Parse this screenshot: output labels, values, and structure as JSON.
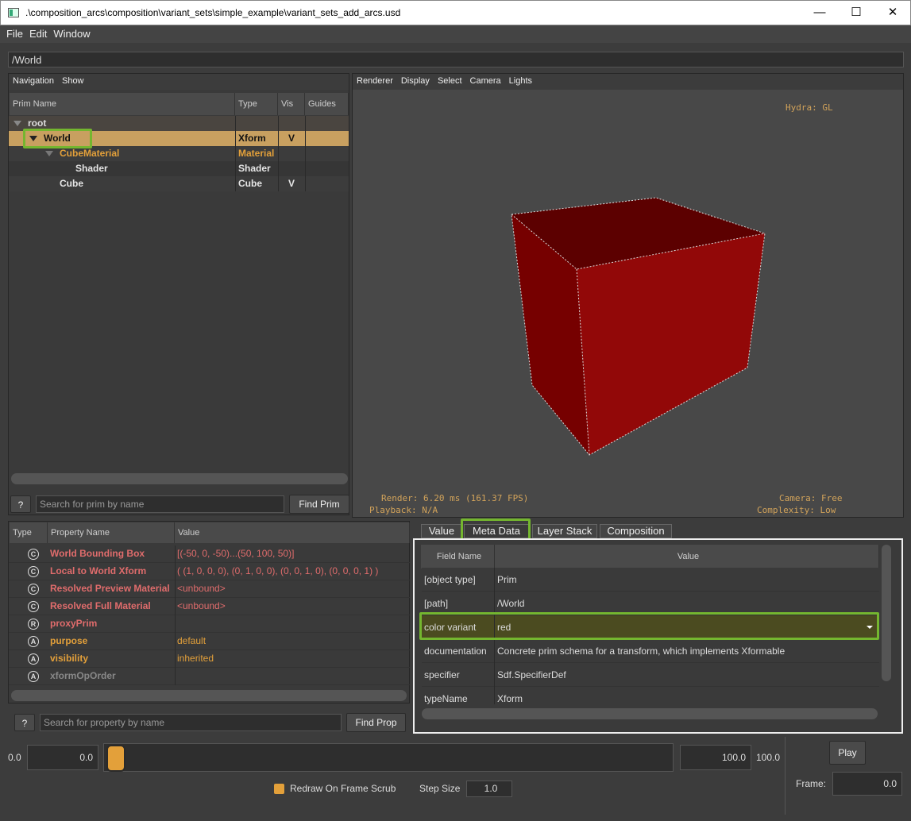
{
  "window": {
    "title": ".\\composition_arcs\\composition\\variant_sets\\simple_example\\variant_sets_add_arcs.usd",
    "minimize": "—",
    "maximize": "☐",
    "close": "✕"
  },
  "menu": [
    "File",
    "Edit",
    "Window"
  ],
  "path": "/World",
  "nav_toolbar": [
    "Navigation",
    "Show"
  ],
  "prim_tree": {
    "columns": [
      "Prim Name",
      "Type",
      "Vis",
      "Guides"
    ],
    "rows": [
      {
        "name": "root",
        "type": "",
        "vis": ""
      },
      {
        "name": "World",
        "type": "Xform",
        "vis": "V"
      },
      {
        "name": "CubeMaterial",
        "type": "Material",
        "vis": ""
      },
      {
        "name": "Shader",
        "type": "Shader",
        "vis": ""
      },
      {
        "name": "Cube",
        "type": "Cube",
        "vis": "V"
      }
    ]
  },
  "prim_search": {
    "help": "?",
    "placeholder": "Search for prim by name",
    "button": "Find Prim"
  },
  "viewport_toolbar": [
    "Renderer",
    "Display",
    "Select",
    "Camera",
    "Lights"
  ],
  "viewport_hud": {
    "renderer": "Hydra: GL",
    "render": "Render: 6.20 ms (161.37 FPS)",
    "playback": "Playback: N/A",
    "camera": "Camera: Free",
    "complexity": "Complexity: Low"
  },
  "properties": {
    "columns": [
      "Type",
      "Property Name",
      "Value"
    ],
    "rows": [
      {
        "icon": "C",
        "name": "World Bounding Box",
        "value": "[(-50, 0, -50)...(50, 100, 50)]",
        "color": "#e06c6c"
      },
      {
        "icon": "C",
        "name": "Local to World Xform",
        "value": "( (1, 0, 0, 0), (0, 1, 0, 0), (0, 0, 1, 0), (0, 0, 0, 1) )",
        "color": "#e06c6c"
      },
      {
        "icon": "C",
        "name": "Resolved Preview Material",
        "value": "<unbound>",
        "color": "#e06c6c"
      },
      {
        "icon": "C",
        "name": "Resolved Full Material",
        "value": "<unbound>",
        "color": "#e06c6c"
      },
      {
        "icon": "R",
        "name": "proxyPrim",
        "value": "",
        "color": "#e06c6c"
      },
      {
        "icon": "A",
        "name": "purpose",
        "value": "default",
        "color": "#e3a03a"
      },
      {
        "icon": "A",
        "name": "visibility",
        "value": "inherited",
        "color": "#e3a03a"
      },
      {
        "icon": "A",
        "name": "xformOpOrder",
        "value": "",
        "color": "#888888"
      }
    ]
  },
  "prop_search": {
    "help": "?",
    "placeholder": "Search for property by name",
    "button": "Find Prop"
  },
  "tabs": [
    "Value",
    "Meta Data",
    "Layer Stack",
    "Composition"
  ],
  "meta": {
    "columns": [
      "Field Name",
      "Value"
    ],
    "rows": [
      {
        "field": "[object type]",
        "value": "Prim"
      },
      {
        "field": "[path]",
        "value": "/World"
      },
      {
        "field": "color variant",
        "value": "red"
      },
      {
        "field": "documentation",
        "value": "Concrete prim schema for a transform, which implements Xformable"
      },
      {
        "field": "specifier",
        "value": "Sdf.SpecifierDef"
      },
      {
        "field": "typeName",
        "value": "Xform"
      }
    ]
  },
  "timeline": {
    "start_label": "0.0",
    "start_value": "0.0",
    "end_value": "100.0",
    "end_label": "100.0",
    "play": "Play",
    "frame_label": "Frame:",
    "frame_value": "0.0",
    "redraw": "Redraw On Frame Scrub",
    "step_label": "Step Size",
    "step_value": "1.0"
  },
  "colors": {
    "selected_row": "#c8a060",
    "highlight": "#74b62f",
    "cube": "#8b0000",
    "attr_orange": "#e3a03a",
    "computed_red": "#e06c6c"
  }
}
